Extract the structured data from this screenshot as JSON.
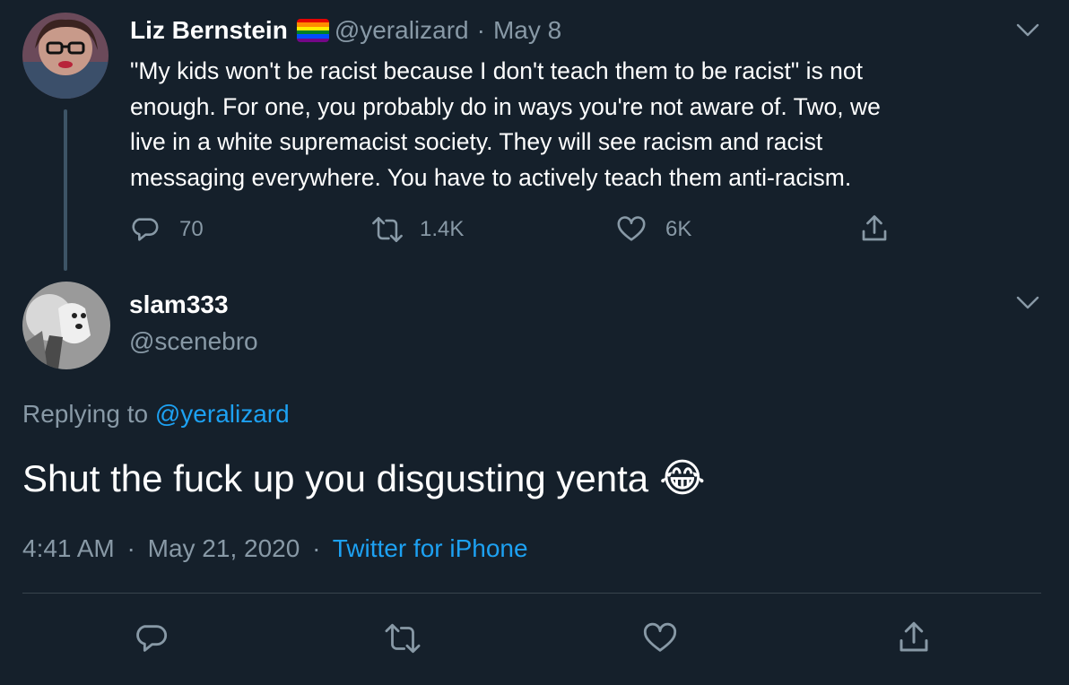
{
  "parent_tweet": {
    "display_name": "Liz Bernstein",
    "handle": "@yeralizard",
    "separator": "·",
    "date": "May 8",
    "text_lines": [
      "\"My kids won't be racist because I don't teach them to be racist\" is not",
      "enough. For one, you probably do in ways you're not aware of. Two, we",
      "live in a white supremacist society. They will see racism and racist",
      "messaging everywhere. You have to actively teach them anti-racism."
    ],
    "replies": "70",
    "retweets": "1.4K",
    "likes": "6K",
    "flag_colors": [
      "#e40303",
      "#ff8c00",
      "#ffed00",
      "#008026",
      "#004dff",
      "#750787"
    ]
  },
  "reply_tweet": {
    "display_name": "slam333",
    "handle": "@scenebro",
    "replying_prefix": "Replying to",
    "replying_handle": "@yeralizard",
    "text": "Shut the fuck up you disgusting yenta",
    "emoji": "😂",
    "time": "4:41 AM",
    "separator": "·",
    "date": "May 21, 2020",
    "separator2": "·",
    "source": "Twitter for iPhone"
  },
  "colors": {
    "background": "#15202b",
    "muted": "#8899a6",
    "accent": "#1da1f2",
    "divider": "#38444d"
  },
  "icons": [
    "chevron-down-icon",
    "reply-icon",
    "retweet-icon",
    "like-icon",
    "share-icon"
  ]
}
